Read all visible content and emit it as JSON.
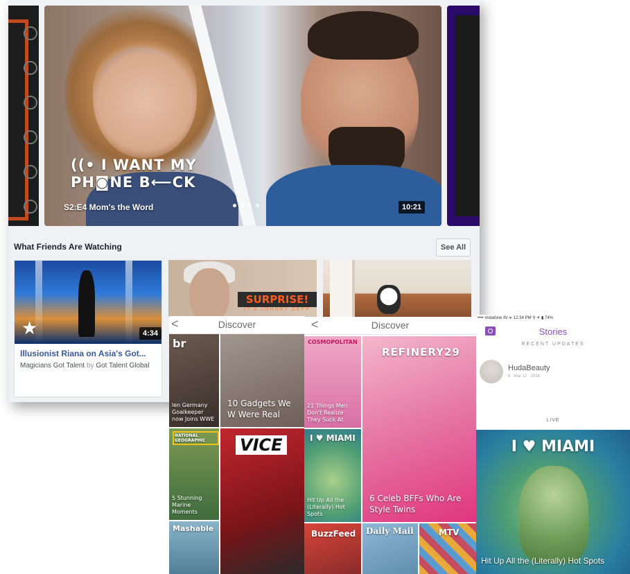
{
  "watch": {
    "hero": {
      "show_logo_line1": "((• I WANT MY",
      "show_logo_line2": "PH◙NE B⟵CK",
      "episode": "S2:E4 Mom's the Word",
      "duration": "10:21",
      "carousel_dots": 4
    },
    "section_title": "What Friends Are Watching",
    "see_all": "See All",
    "videos": [
      {
        "title": "Illusionist Riana on Asia's Got...",
        "page": "Magicians Got Talent",
        "by": "by",
        "channel": "Got Talent Global",
        "duration": "4:34"
      },
      {
        "thumb_text": "SURPRISE!",
        "thumb_subtext": "IT'S JOHNNY DEPP"
      },
      {}
    ]
  },
  "discover_a": {
    "title": "Discover",
    "back": "<",
    "tiles": [
      {
        "logo": "br",
        "headline": "len Germany Goalkeeper now Joins WWE"
      },
      {
        "headline": "10 Gadgets We W Were Real"
      },
      {
        "logo": "NATIONAL GEOGRAPHIC",
        "headline": "5 Stunning Marine Moments"
      },
      {
        "logo": "VICE"
      },
      {
        "logo": "Mashable"
      }
    ]
  },
  "discover_b": {
    "title": "Discover",
    "back": "<",
    "tiles": [
      {
        "logo": "COSMOPOLITAN",
        "headline": "21 Things Men Don't Realize They Suck At"
      },
      {
        "logo": "REFINERY29",
        "headline": "6 Celeb BFFs Who Are Style Twins"
      },
      {
        "logo": "I ♥ MIAMI",
        "headline": "Hit Up All the (Literally) Hot Spots"
      },
      {
        "logo": "BuzzFeed"
      },
      {
        "logo": "Daily Mail"
      },
      {
        "logo": "MTV"
      }
    ]
  },
  "stories": {
    "status_bar": "•••• Vodafone IN ᯤ   12:34 PM      ⚲ ✈ ▮ 74%",
    "title": "Stories",
    "recent_label": "RECENT UPDATES",
    "story_name": "HudaBeauty",
    "story_time": "8 · Mar 12 · 2016",
    "live_label": "LIVE",
    "live_title": "I ♥ MIAMI",
    "live_caption": "Hit Up All the (Literally) Hot Spots"
  },
  "colors": {
    "facebook_link": "#385898",
    "snap_purple": "#8c4fb6",
    "surprise_orange": "#ff5a1f",
    "refinery_pink": "#e0357e"
  }
}
